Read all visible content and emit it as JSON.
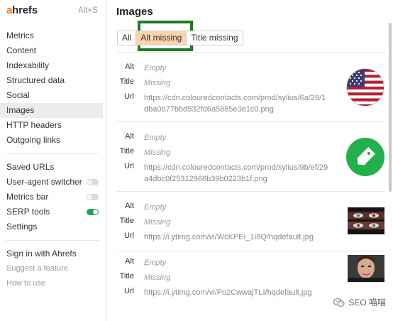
{
  "sidebar": {
    "brand": {
      "first_letter": "a",
      "rest": "hrefs",
      "shortcut": "Alt+S"
    },
    "group1": [
      {
        "label": "Metrics"
      },
      {
        "label": "Content"
      },
      {
        "label": "Indexability"
      },
      {
        "label": "Structured data"
      },
      {
        "label": "Social"
      },
      {
        "label": "Images",
        "active": true
      },
      {
        "label": "HTTP headers"
      },
      {
        "label": "Outgoing links"
      }
    ],
    "group2": [
      {
        "label": "Saved URLs"
      },
      {
        "label": "User-agent switcher",
        "toggle": false
      },
      {
        "label": "Metrics bar",
        "toggle": false
      },
      {
        "label": "SERP tools",
        "toggle": true
      },
      {
        "label": "Settings"
      }
    ],
    "group3": [
      {
        "label": "Sign in with Ahrefs"
      },
      {
        "label": "Suggest a feature"
      },
      {
        "label": "How to use"
      }
    ]
  },
  "main": {
    "title": "Images",
    "tabs": [
      {
        "label": "All"
      },
      {
        "label": "Alt missing",
        "selected": true
      },
      {
        "label": "Title missing"
      }
    ],
    "field_labels": {
      "alt": "Alt",
      "title": "Title",
      "url": "Url"
    },
    "images": [
      {
        "alt": "Empty",
        "title": "Missing",
        "url_line1": "https://cdn.colouredcontacts.com/prod/sylius/6a/29/1",
        "url_line2": "dba0b77bbd532fd6a5885e3e1c0.png",
        "thumb": "us-flag-icon"
      },
      {
        "alt": "Empty",
        "title": "Missing",
        "url_line1": "https://cdn.colouredcontacts.com/prod/sylius/9b/ef/29",
        "url_line2": "a4dbc0f25312966b39b0223b1f.png",
        "thumb": "price-tag-icon"
      },
      {
        "alt": "Empty",
        "title": "Missing",
        "url_line1": "https://i.ytimg.com/vi/WcKPEi_1I8Q/hqdefault.jpg",
        "url_line2": "",
        "thumb": "video-thumbnail-eyes"
      },
      {
        "alt": "Empty",
        "title": "Missing",
        "url_line1": "https://i.ytimg.com/vi/Po2CwwajTLI/hqdefault.jpg",
        "url_line2": "",
        "thumb": "video-thumbnail-face"
      }
    ]
  },
  "watermark": {
    "text": "SEO 喵喵"
  },
  "colors": {
    "accent_orange": "#f97316",
    "tab_selected": "#fcd3b0",
    "highlight_green": "#1e7b26",
    "toggle_on": "#22a35a"
  }
}
